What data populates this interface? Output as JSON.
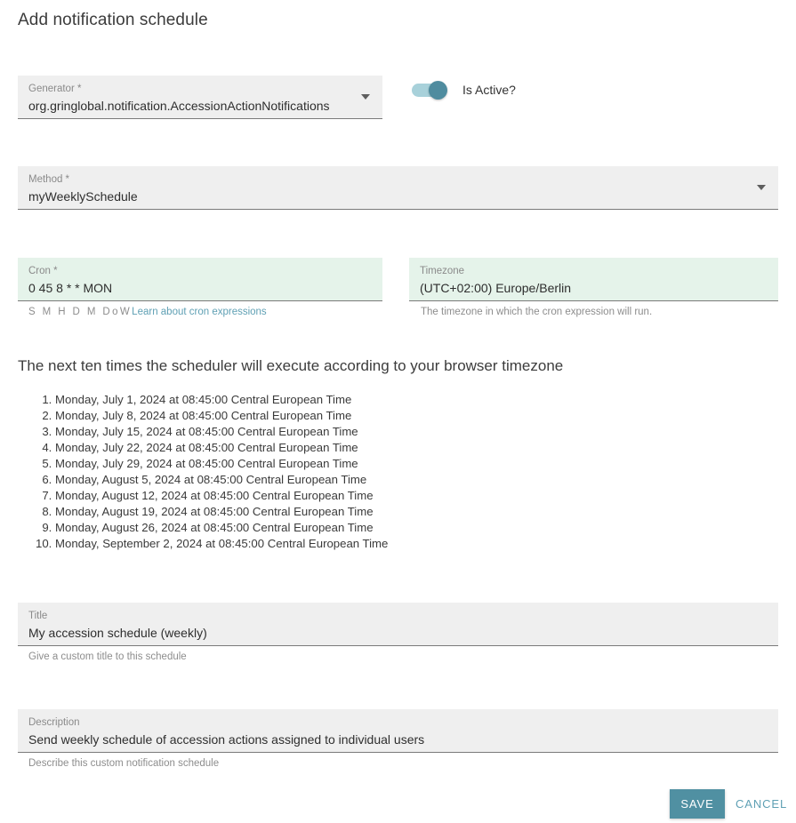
{
  "page": {
    "title": "Add notification schedule"
  },
  "generator": {
    "label": "Generator *",
    "value": "org.gringlobal.notification.AccessionActionNotifications",
    "icon": "chevron-down-icon"
  },
  "is_active": {
    "label": "Is Active?",
    "checked": true,
    "track_color": "#a8d1da",
    "thumb_color": "#4f8c9f"
  },
  "method": {
    "label": "Method *",
    "value": "myWeeklySchedule",
    "icon": "chevron-down-icon"
  },
  "cron": {
    "label": "Cron *",
    "value": "0 45 8 * * MON",
    "legend": "S M H D M DoW",
    "link_text": "Learn about cron expressions",
    "field_color": "#e5f3ea"
  },
  "timezone": {
    "label": "Timezone",
    "value": "(UTC+02:00) Europe/Berlin",
    "hint": "The timezone in which the cron expression will run.",
    "field_color": "#e5f3ea"
  },
  "preview": {
    "heading": "The next ten times the scheduler will execute according to your browser timezone",
    "items": [
      "Monday, July 1, 2024 at 08:45:00 Central European Time",
      "Monday, July 8, 2024 at 08:45:00 Central European Time",
      "Monday, July 15, 2024 at 08:45:00 Central European Time",
      "Monday, July 22, 2024 at 08:45:00 Central European Time",
      "Monday, July 29, 2024 at 08:45:00 Central European Time",
      "Monday, August 5, 2024 at 08:45:00 Central European Time",
      "Monday, August 12, 2024 at 08:45:00 Central European Time",
      "Monday, August 19, 2024 at 08:45:00 Central European Time",
      "Monday, August 26, 2024 at 08:45:00 Central European Time",
      "Monday, September 2, 2024 at 08:45:00 Central European Time"
    ]
  },
  "title_field": {
    "label": "Title",
    "value": "My accession schedule (weekly)",
    "hint": "Give a custom title to this schedule"
  },
  "description_field": {
    "label": "Description",
    "value": "Send weekly schedule of accession actions assigned to individual users",
    "hint": "Describe this custom notification schedule"
  },
  "footer": {
    "save_label": "SAVE",
    "cancel_label": "CANCEL",
    "save_color": "#5090a2",
    "cancel_color": "#5fa0b4"
  }
}
